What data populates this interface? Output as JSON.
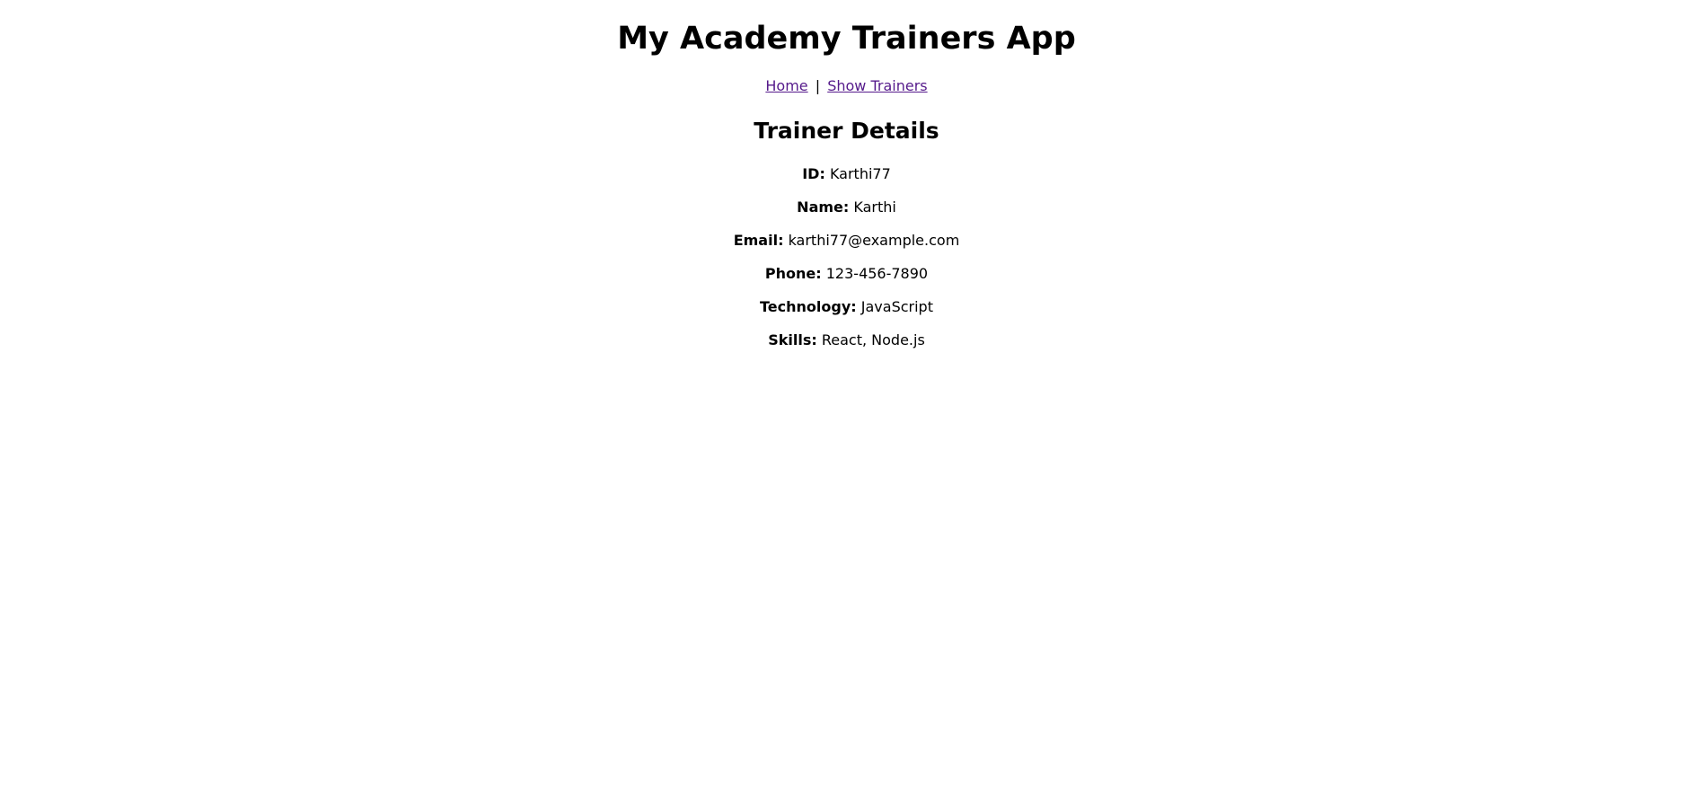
{
  "app": {
    "title": "My Academy Trainers App"
  },
  "nav": {
    "home_label": "Home",
    "separator": "|",
    "show_trainers_label": "Show Trainers",
    "link_color": "#551a8b"
  },
  "trainer": {
    "section_title": "Trainer Details",
    "fields": [
      {
        "label": "ID:",
        "value": "Karthi77"
      },
      {
        "label": "Name:",
        "value": "Karthi"
      },
      {
        "label": "Email:",
        "value": "karthi77@example.com"
      },
      {
        "label": "Phone:",
        "value": "123-456-7890"
      },
      {
        "label": "Technology:",
        "value": "JavaScript"
      },
      {
        "label": "Skills:",
        "value": "React, Node.js"
      }
    ]
  }
}
